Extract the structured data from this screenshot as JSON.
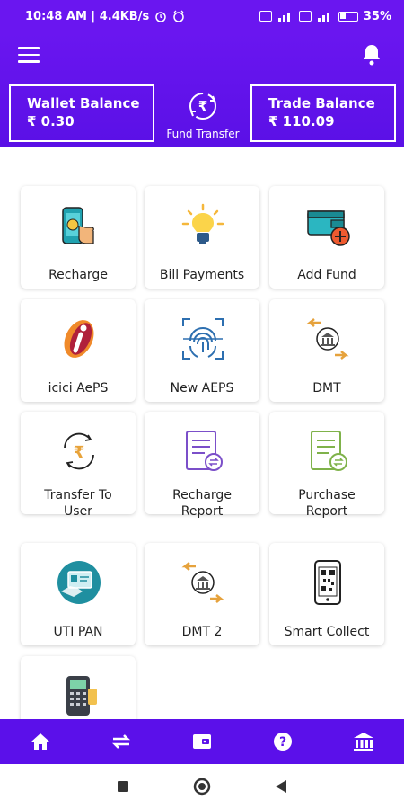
{
  "status_bar": {
    "time_info": "10:48 AM | 4.4KB/s",
    "battery": "35%"
  },
  "header": {
    "wallet_balance": {
      "title": "Wallet Balance",
      "value": "₹ 0.30"
    },
    "fund_transfer": {
      "label": "Fund Transfer",
      "symbol": "₹"
    },
    "trade_balance": {
      "title": "Trade Balance",
      "value": "₹ 110.09"
    }
  },
  "services": [
    {
      "label": "Recharge",
      "icon": "phone-recharge-icon"
    },
    {
      "label": "Bill Payments",
      "icon": "lightbulb-icon"
    },
    {
      "label": "Add Fund",
      "icon": "wallet-add-icon"
    },
    {
      "label": "icici AePS",
      "icon": "icici-logo-icon"
    },
    {
      "label": "New AEPS",
      "icon": "fingerprint-icon"
    },
    {
      "label": "DMT",
      "icon": "bank-transfer-icon"
    },
    {
      "label": "Transfer To\nUser",
      "icon": "rupee-transfer-icon"
    },
    {
      "label": "Recharge\nReport",
      "icon": "report-icon"
    },
    {
      "label": "Purchase\nReport",
      "icon": "purchase-report-icon"
    },
    {
      "label": "UTI PAN",
      "icon": "pan-card-icon"
    },
    {
      "label": "DMT 2",
      "icon": "bank-transfer-icon"
    },
    {
      "label": "Smart Collect",
      "icon": "qr-phone-icon"
    },
    {
      "label": "",
      "icon": "pos-terminal-icon"
    }
  ],
  "bottom_nav": [
    "home-icon",
    "transfer-icon",
    "wallet-icon",
    "help-icon",
    "bank-icon"
  ],
  "colors": {
    "primary": "#6a16f0",
    "nav": "#5b10ea",
    "accent_orange": "#f2a34a",
    "accent_teal": "#1f9aa8"
  }
}
